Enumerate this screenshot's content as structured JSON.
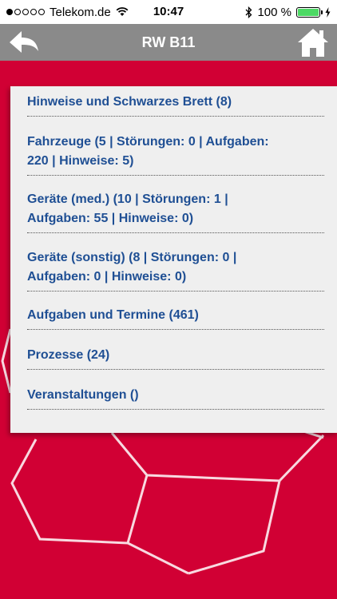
{
  "status_bar": {
    "carrier": "Telekom.de",
    "time": "10:47",
    "battery": "100 %",
    "signal_bars_full": 1,
    "signal_bars_total": 5
  },
  "nav": {
    "title": "RW B11",
    "back_icon": "back-arrow-icon",
    "home_icon": "home-icon"
  },
  "menu": {
    "items": [
      {
        "label": "Hinweise und Schwarzes Brett (8)"
      },
      {
        "label_line1": "Fahrzeuge (5 | Störungen: 0 | Aufgaben:",
        "label_line2": "220 | Hinweise: 5)"
      },
      {
        "label_line1": "Geräte (med.) (10 | Störungen: 1 |",
        "label_line2": "Aufgaben: 55 | Hinweise: 0)"
      },
      {
        "label_line1": "Geräte (sonstig) (8 | Störungen: 0 |",
        "label_line2": "Aufgaben: 0 | Hinweise: 0)"
      },
      {
        "label": "Aufgaben und Termine (461)"
      },
      {
        "label": "Prozesse (24)"
      },
      {
        "label": "Veranstaltungen ()"
      }
    ]
  },
  "colors": {
    "background": "#d10034",
    "navbar": "#8a8a8a",
    "panel": "#efefef",
    "link": "#1f4f94",
    "battery": "#4cd964"
  }
}
